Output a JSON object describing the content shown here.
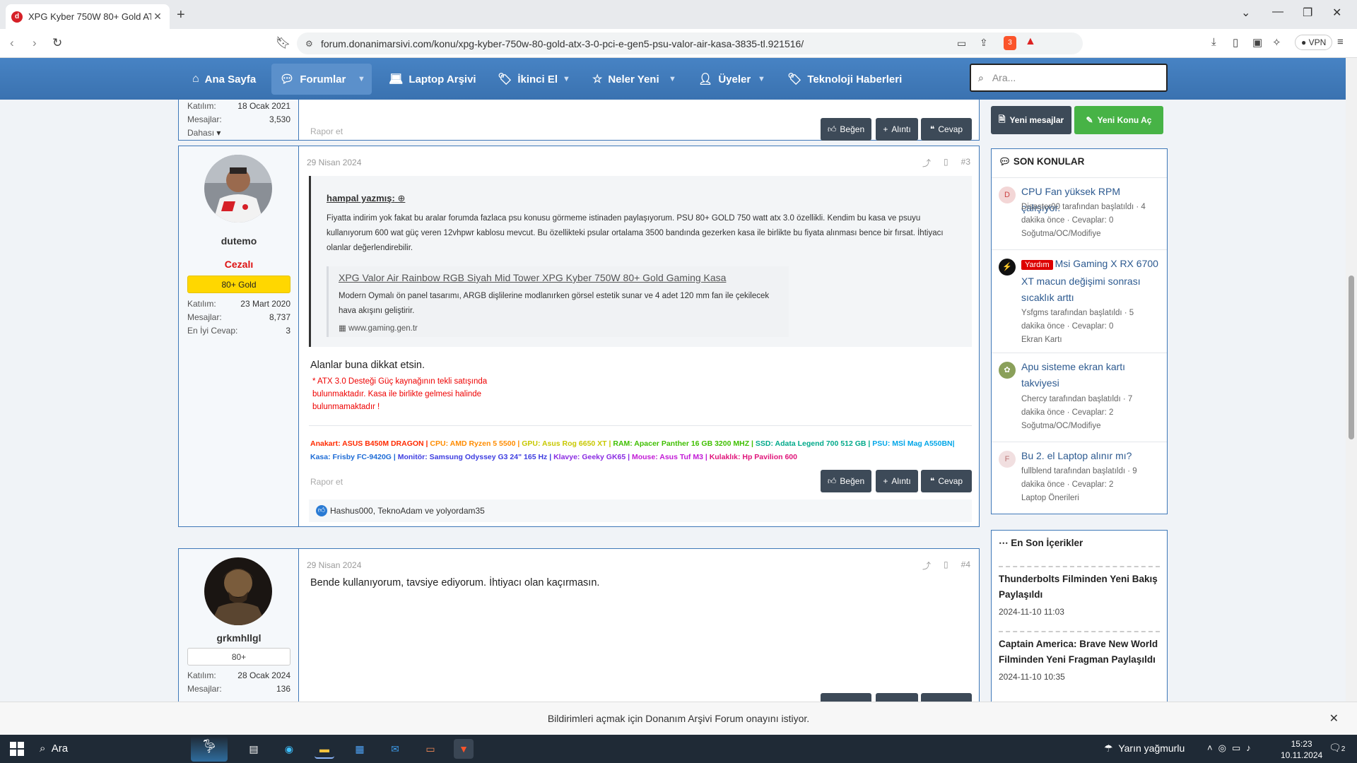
{
  "browser": {
    "tab_title": "XPG Kyber 750W 80+ Gold ATX",
    "url": "forum.donanimarsivi.com/konu/xpg-kyber-750w-80-gold-atx-3-0-pci-e-gen5-psu-valor-air-kasa-3835-tl.921516/",
    "shield_badge": "3",
    "vpn_label": "VPN"
  },
  "site_nav": {
    "items": [
      {
        "label": "Ana Sayfa"
      },
      {
        "label": "Forumlar"
      },
      {
        "label": "Laptop Arşivi"
      },
      {
        "label": "İkinci El"
      },
      {
        "label": "Neler Yeni"
      },
      {
        "label": "Üyeler"
      },
      {
        "label": "Teknoloji Haberleri"
      }
    ],
    "search_placeholder": "Ara..."
  },
  "prev_post": {
    "join_label": "Katılım:",
    "join_value": "18 Ocak 2021",
    "msgs_label": "Mesajlar:",
    "msgs_value": "3,530",
    "more_label": "Dahası",
    "report": "Rapor et",
    "like": "Beğen",
    "quote": "Alıntı",
    "reply": "Cevap"
  },
  "post3": {
    "username": "dutemo",
    "user_title": "Cezalı",
    "banner": "80+ Gold",
    "join_label": "Katılım:",
    "join_value": "23 Mart 2020",
    "msgs_label": "Mesajlar:",
    "msgs_value": "8,737",
    "best_label": "En İyi Cevap:",
    "best_value": "3",
    "date": "29 Nisan 2024",
    "number": "#3",
    "quote_author": "hampal yazmış:",
    "quote_text": "Fiyatta indirim yok fakat bu aralar forumda fazlaca psu konusu görmeme istinaden paylaşıyorum. PSU 80+ GOLD 750 watt atx 3.0 özellikli. Kendim bu kasa ve psuyu kullanıyorum 600 wat güç veren 12vhpwr kablosu mevcut. Bu özellikteki psular ortalama 3500 bandında gezerken kasa ile birlikte bu fiyata alınması bence bir fırsat. İhtiyacı olanlar değerlendirebilir.",
    "unfurl_title": "XPG Valor Air Rainbow RGB Siyah Mid Tower XPG Kyber 750W 80+ Gold Gaming Kasa",
    "unfurl_desc": "Modern Oymalı ön panel tasarımı, ARGB dişlilerine modlanırken görsel estetik sunar ve 4 adet 120 mm fan ile çekilecek hava akışını geliştirir.",
    "unfurl_url": "www.gaming.gen.tr",
    "body": "Alanlar buna dikkat etsin.",
    "warning_lines": [
      "* ATX 3.0 Desteği Güç kaynağının tekli satışında",
      "bulunmaktadır. Kasa ile birlikte gelmesi halinde",
      "bulunmamaktadır !"
    ],
    "signature": [
      {
        "text": "Anakart: ASUS B450M DRAGON | ",
        "color": "#ff2a00"
      },
      {
        "text": "CPU: AMD Ryzen 5 5500 | ",
        "color": "#ff8c00"
      },
      {
        "text": "GPU: Asus Rog 6650 XT | ",
        "color": "#c8c800"
      },
      {
        "text": "RAM: Apacer Panther 16 GB 3200 MHZ | ",
        "color": "#3fbf00"
      },
      {
        "text": "SSD: Adata Legend 700 512 GB | ",
        "color": "#00a98a"
      },
      {
        "text": "PSU: MSİ Mag A550BN| ",
        "color": "#00a6e8"
      },
      {
        "text": "Kasa: Frisby FC-9420G | ",
        "color": "#1e6cd6"
      },
      {
        "text": "Monitör: Samsung Odyssey G3 24\" 165 Hz | ",
        "color": "#3d3de0"
      },
      {
        "text": "Klavye: Geeky GK65 | ",
        "color": "#8a2be2"
      },
      {
        "text": "Mouse: Asus Tuf M3 | ",
        "color": "#c21bd6"
      },
      {
        "text": "Kulaklık: Hp Pavilion 600",
        "color": "#e0157a"
      }
    ],
    "report": "Rapor et",
    "like": "Beğen",
    "quote": "Alıntı",
    "reply": "Cevap",
    "likers_a": "Hashus000",
    "likers_b": "TeknoAdam",
    "likers_and": "ve",
    "likers_c": "yolyordam35"
  },
  "post4": {
    "username": "grkmhllgl",
    "banner": "80+",
    "join_label": "Katılım:",
    "join_value": "28 Ocak 2024",
    "msgs_label": "Mesajlar:",
    "msgs_value": "136",
    "date": "29 Nisan 2024",
    "number": "#4",
    "body": "Bende kullanıyorum, tavsiye ediyorum. İhtiyacı olan kaçırmasın."
  },
  "sidebar": {
    "new_messages": "Yeni mesajlar",
    "new_thread": "Yeni Konu Aç",
    "recent_title": "SON KONULAR",
    "threads": [
      {
        "avatar": "D",
        "title": "CPU Fan yüksek RPM çalışıyor.",
        "meta1": "Disaster00 tarafından başlatıldı · 4",
        "meta2": "dakika önce · Cevaplar: 0",
        "meta3": "Soğutma/OC/Modifiye"
      },
      {
        "avatar": "",
        "badge": "Yardım",
        "title": "Msi Gaming X RX 6700 XT macun değişimi sonrası sıcaklık arttı",
        "meta1": "Ysfgms tarafından başlatıldı · 5",
        "meta2": "dakika önce · Cevaplar: 0",
        "meta3": "Ekran Kartı"
      },
      {
        "avatar": "",
        "title": "Apu sisteme ekran kartı takviyesi",
        "meta1": "Chercy tarafından başlatıldı · 7",
        "meta2": "dakika önce · Cevaplar: 2",
        "meta3": "Soğutma/OC/Modifiye"
      },
      {
        "avatar": "F",
        "title": "Bu 2. el Laptop alınır mı?",
        "meta1": "fullblend tarafından başlatıldı · 9",
        "meta2": "dakika önce · Cevaplar: 2",
        "meta3": "Laptop Önerileri"
      }
    ],
    "latest_title": "En Son İçerikler",
    "latest": [
      {
        "title": "Thunderbolts Filminden Yeni Bakış Paylaşıldı",
        "date": "2024-11-10 11:03"
      },
      {
        "title": "Captain America: Brave New World Filminden Yeni Fragman Paylaşıldı",
        "date": "2024-11-10 10:35"
      }
    ]
  },
  "notification": {
    "text_a": "Bildirimleri açmak için",
    "text_site": "Donanım Arşivi Forum",
    "text_b": "onayını istiyor."
  },
  "taskbar": {
    "search": "Ara",
    "weather": "Yarın yağmurlu",
    "time": "15:23",
    "date": "10.11.2024",
    "notif_count": "2"
  }
}
